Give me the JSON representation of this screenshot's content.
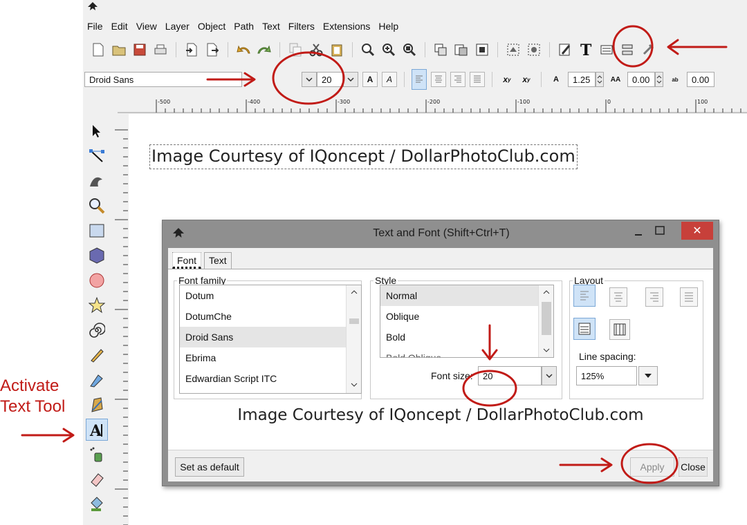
{
  "menubar": {
    "items": [
      "File",
      "Edit",
      "View",
      "Layer",
      "Object",
      "Path",
      "Text",
      "Filters",
      "Extensions",
      "Help"
    ]
  },
  "fontbar": {
    "font_family": "Droid Sans",
    "font_size": "20",
    "line_spacing": "1.25",
    "letter_spacing": "0.00",
    "word_spacing": "0.00"
  },
  "ruler": {
    "ticks": [
      "-500",
      "-400",
      "-300",
      "-200",
      "-100",
      "0",
      "100"
    ]
  },
  "canvas": {
    "text": "Image Courtesy of IQoncept / DollarPhotoClub.com"
  },
  "dialog": {
    "title": "Text and Font (Shift+Ctrl+T)",
    "tabs": [
      "Font",
      "Text"
    ],
    "font_family_label": "Font family",
    "fonts": [
      "Dotum",
      "DotumChe",
      "Droid Sans",
      "Ebrima",
      "Edwardian Script ITC"
    ],
    "selected_font": "Droid Sans",
    "style_label": "Style",
    "styles": [
      "Normal",
      "Oblique",
      "Bold",
      "Bold Oblique"
    ],
    "font_size_label": "Font size:",
    "font_size": "20",
    "layout_label": "Layout",
    "line_spacing_label": "Line spacing:",
    "line_spacing": "125%",
    "preview": "Image Courtesy of IQoncept / DollarPhotoClub.com",
    "set_default": "Set as default",
    "apply": "Apply",
    "close": "Close"
  },
  "annotation": {
    "line1": "Activate",
    "line2": "Text Tool"
  },
  "colors": {
    "annotation_red": "#c11b17",
    "close_button": "#c7403a",
    "active_blue": "#cfe3f7"
  }
}
